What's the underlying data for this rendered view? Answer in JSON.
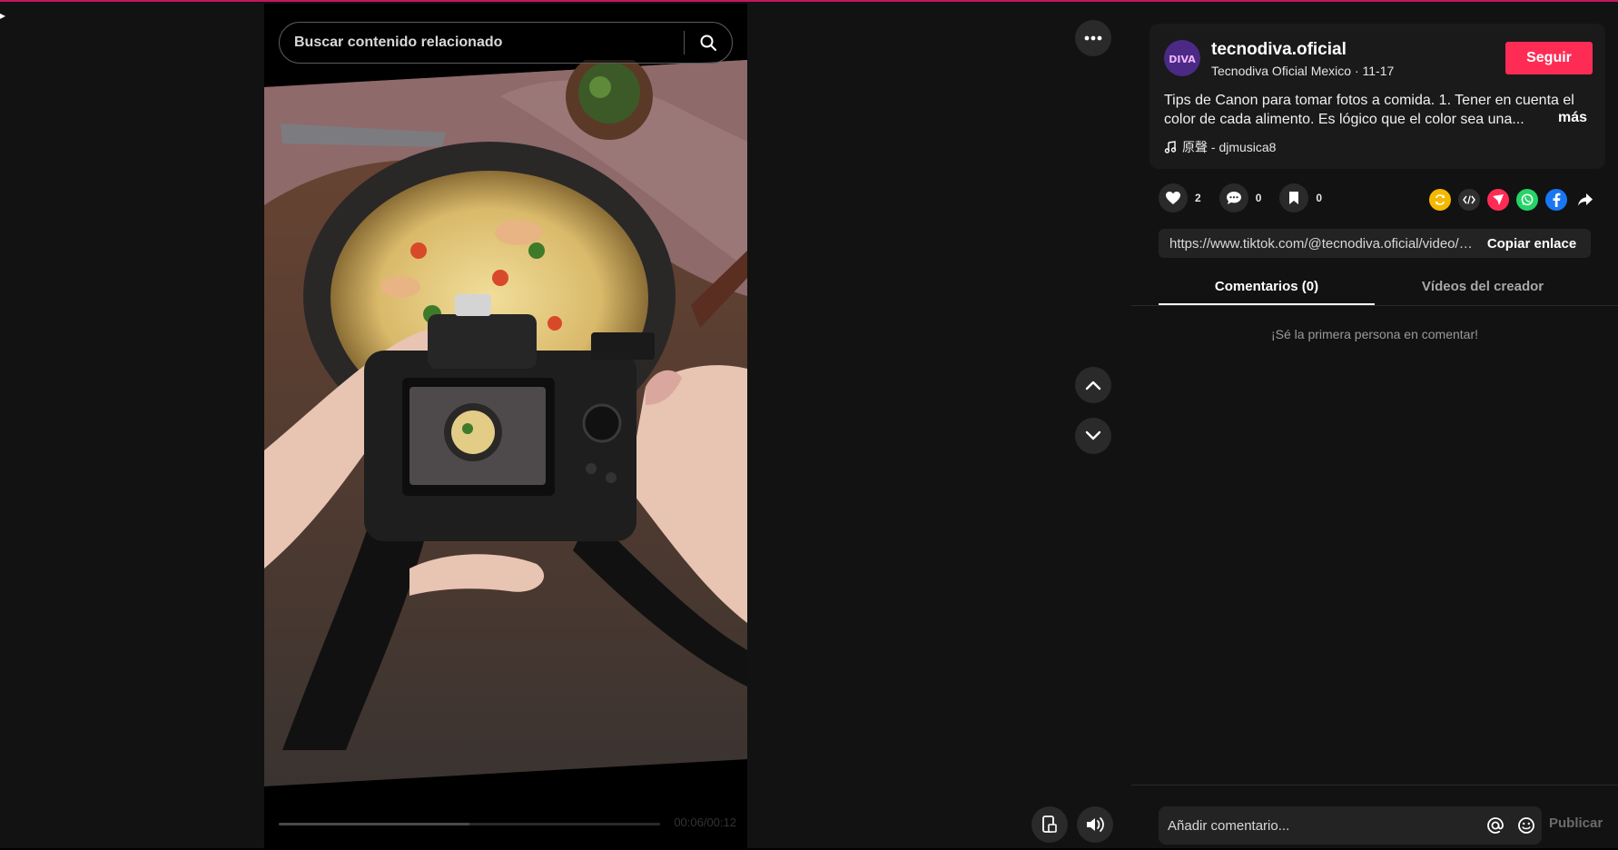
{
  "search": {
    "placeholder": "Buscar contenido relacionado"
  },
  "player": {
    "time": "00:06/00:12",
    "progress": 0.5
  },
  "author": {
    "username": "tecnodiva.oficial",
    "subtitle": "Tecnodiva Oficial Mexico · 11-17",
    "avatar_text": "DIVA",
    "follow_label": "Seguir"
  },
  "post": {
    "description": "Tips de Canon para tomar fotos a comida. 1. Tener en cuenta el color de cada alimento. Es lógico que el color sea una...",
    "more_label": "más",
    "music": "原聲 - djmusica8"
  },
  "actions": {
    "likes": "2",
    "comments": "0",
    "saves": "0"
  },
  "share": {
    "url": "https://www.tiktok.com/@tecnodiva.oficial/video/7...",
    "copy_label": "Copiar enlace"
  },
  "tabs": [
    {
      "label": "Comentarios (0)"
    },
    {
      "label": "Vídeos del creador"
    }
  ],
  "comments": {
    "empty_message": "¡Sé la primera persona en comentar!",
    "input_placeholder": "Añadir comentario...",
    "publish_label": "Publicar"
  },
  "colors": {
    "accent": "#fe2c55",
    "background": "#121212"
  }
}
